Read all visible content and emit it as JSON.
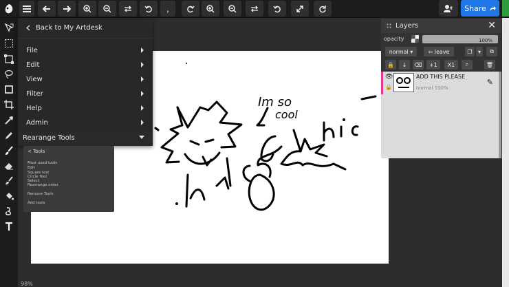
{
  "topbar": {
    "share_label": "Share",
    "comma": ","
  },
  "main_menu": {
    "back_label": "Back to My Artdesk",
    "items": [
      {
        "label": "File"
      },
      {
        "label": "Edit"
      },
      {
        "label": "View"
      },
      {
        "label": "Filter"
      },
      {
        "label": "Help"
      },
      {
        "label": "Admin"
      }
    ],
    "rearrange_label": "Rearange Tools"
  },
  "tools_panel": {
    "title": "Tools",
    "lines": [
      "Most used tools",
      "Edit",
      "Square tool",
      "Circle Tool",
      "Select",
      "Rearrange order",
      "Remove Tools",
      "Add tools"
    ]
  },
  "layers": {
    "title": "Layers",
    "opacity_label": "opacity",
    "opacity_value": "100%",
    "blend_mode": "normal",
    "leave_label": "leave",
    "merge_label": "+1",
    "clear_label": "X1",
    "layer_items": [
      {
        "name": "ADD THIS PLEASE",
        "meta": "normal 100%"
      }
    ]
  },
  "canvas": {
    "drawing_text_1": "Im so",
    "drawing_text_2": "cool",
    "drawing_text_3": "hi",
    "drawing_text_4": "c"
  },
  "status": {
    "zoom": "98%"
  },
  "colors": {
    "accent": "#1f77e8",
    "layer_highlight": "#e0389b",
    "panel_bg": "#282828",
    "toolbar_bg": "#1c1c1c"
  }
}
